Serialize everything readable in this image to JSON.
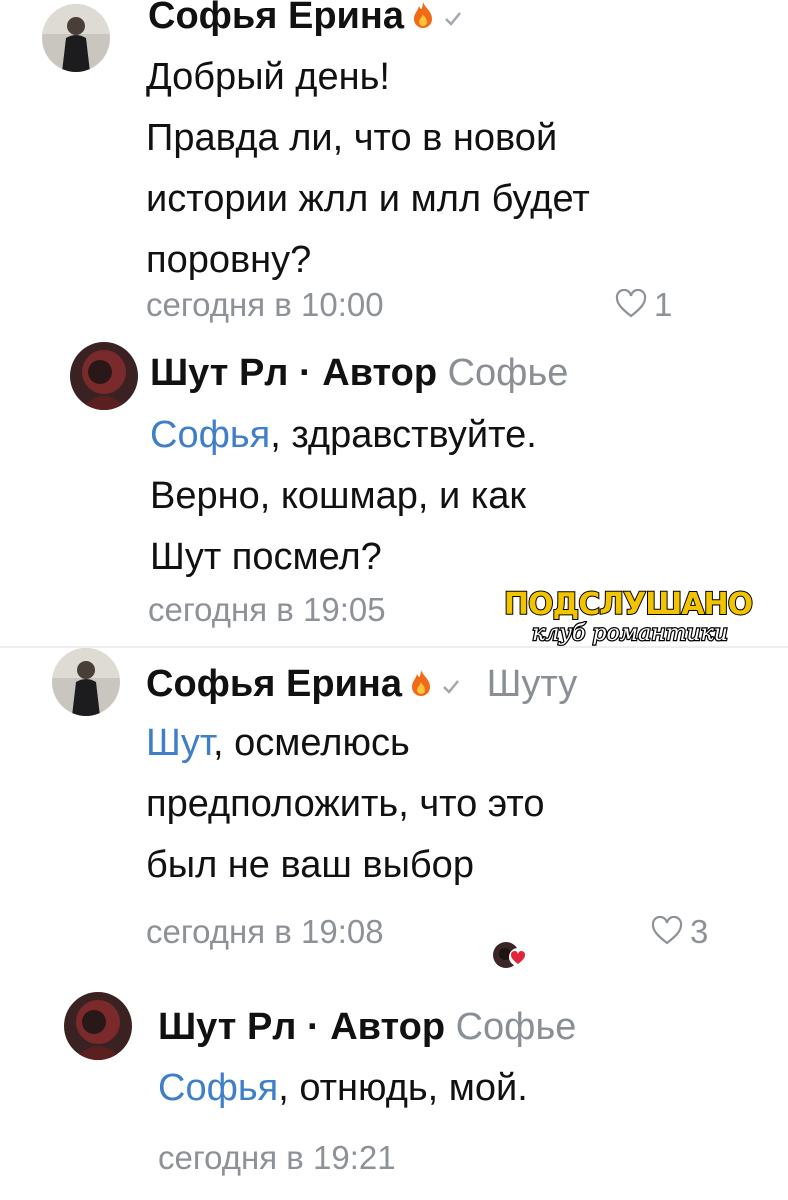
{
  "comments": [
    {
      "author": "Софья Ерина",
      "reply_to": "",
      "mention": "",
      "text": "Добрый день!\nПравда ли, что в новой\nистории жлл и млл будет\nпоровну?",
      "time": "сегодня в 10:00",
      "likes": "1"
    },
    {
      "author": "Шут Рл · Автор",
      "reply_to": "Софье",
      "mention": "Софья",
      "text": ", здравствуйте.\nВерно, кошмар, и как\nШут посмел?",
      "time": "сегодня в 19:05",
      "likes": ""
    },
    {
      "author": "Софья Ерина",
      "reply_to": "Шуту",
      "mention": "Шут",
      "text": ", осмелюсь\nпредположить, что это\nбыл не ваш выбор",
      "time": "сегодня в 19:08",
      "likes": "3"
    },
    {
      "author": "Шут Рл · Автор",
      "reply_to": "Софье",
      "mention": "Софья",
      "text": ", отнюдь, мой.",
      "time": "сегодня в 19:21",
      "likes": ""
    }
  ],
  "watermark": {
    "line1": "ПОДСЛУШАНО",
    "line2": "клуб романтики"
  },
  "colors": {
    "mention": "#3f7ec8",
    "meta_gray": "#8d9299",
    "fire": "#f06a1a",
    "heart_red": "#e0263c"
  },
  "icons": [
    "fire-icon",
    "verified-check-icon",
    "heart-outline-icon",
    "liked-by-author-icon"
  ]
}
